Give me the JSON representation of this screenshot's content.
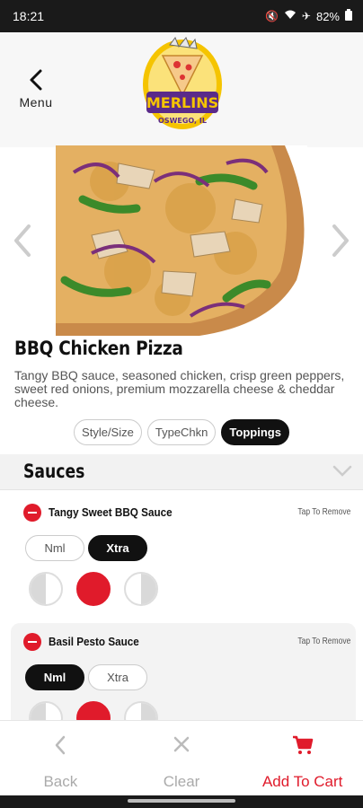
{
  "status": {
    "time": "18:21",
    "battery": "82%"
  },
  "header": {
    "back_label": "Menu"
  },
  "product": {
    "title": "BBQ Chicken Pizza",
    "description": "Tangy BBQ sauce, seasoned chicken, crisp green peppers, sweet red onions, premium mozzarella cheese & cheddar cheese."
  },
  "tabs": [
    {
      "label": "Style/Size",
      "active": false
    },
    {
      "label": "TypeChkn",
      "active": false
    },
    {
      "label": "Toppings",
      "active": true
    }
  ],
  "section": {
    "title": "Sauces"
  },
  "sauces": [
    {
      "name": "Tangy Sweet BBQ Sauce",
      "tap_label": "Tap To Remove",
      "options": [
        "Nml",
        "Xtra"
      ],
      "selected": "Xtra"
    },
    {
      "name": "Basil Pesto Sauce",
      "tap_label": "Tap To Remove",
      "options": [
        "Nml",
        "Xtra"
      ],
      "selected": "Nml"
    }
  ],
  "bottom": {
    "back": "Back",
    "clear": "Clear",
    "cart": "Add To Cart"
  },
  "colors": {
    "accent": "#e01b2b",
    "dark": "#111111"
  }
}
